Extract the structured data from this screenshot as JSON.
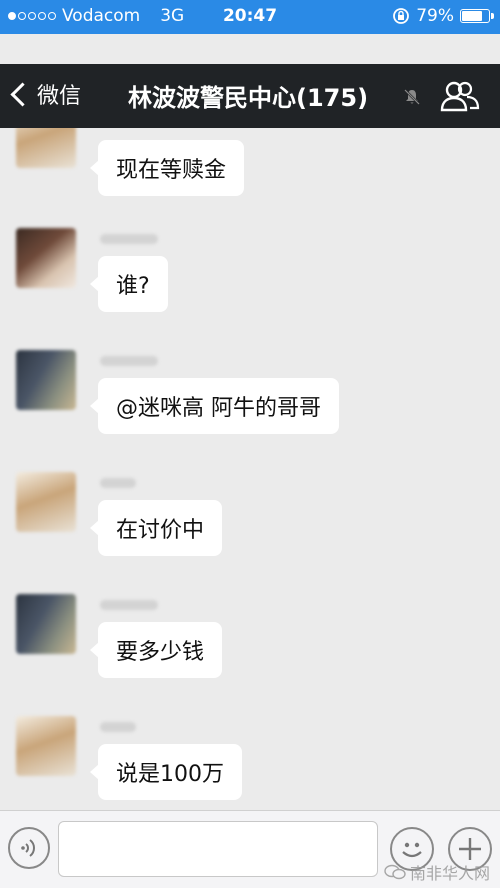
{
  "status_bar": {
    "carrier": "Vodacom",
    "network": "3G",
    "time": "20:47",
    "battery": "79%",
    "battery_level": 0.79,
    "signal_bars": 1
  },
  "nav": {
    "back_label": "微信",
    "title": "林波波警民中心(175)"
  },
  "colors": {
    "status_bar_bg": "#2a8ae6",
    "nav_bg": "#202326",
    "chat_bg": "#ebebeb",
    "bubble_bg": "#ffffff"
  },
  "messages": [
    {
      "text": "现在等赎金"
    },
    {
      "text": "谁?"
    },
    {
      "text": "@迷咪高 阿牛的哥哥"
    },
    {
      "text": "在讨价中"
    },
    {
      "text": "要多少钱"
    },
    {
      "text": "说是100万"
    }
  ],
  "watermark": "南非华人网",
  "icons": {
    "back": "chevron-left-icon",
    "mute": "bell-off-icon",
    "members": "group-icon",
    "voice": "voice-icon",
    "emoji": "emoji-icon",
    "more": "plus-icon"
  }
}
